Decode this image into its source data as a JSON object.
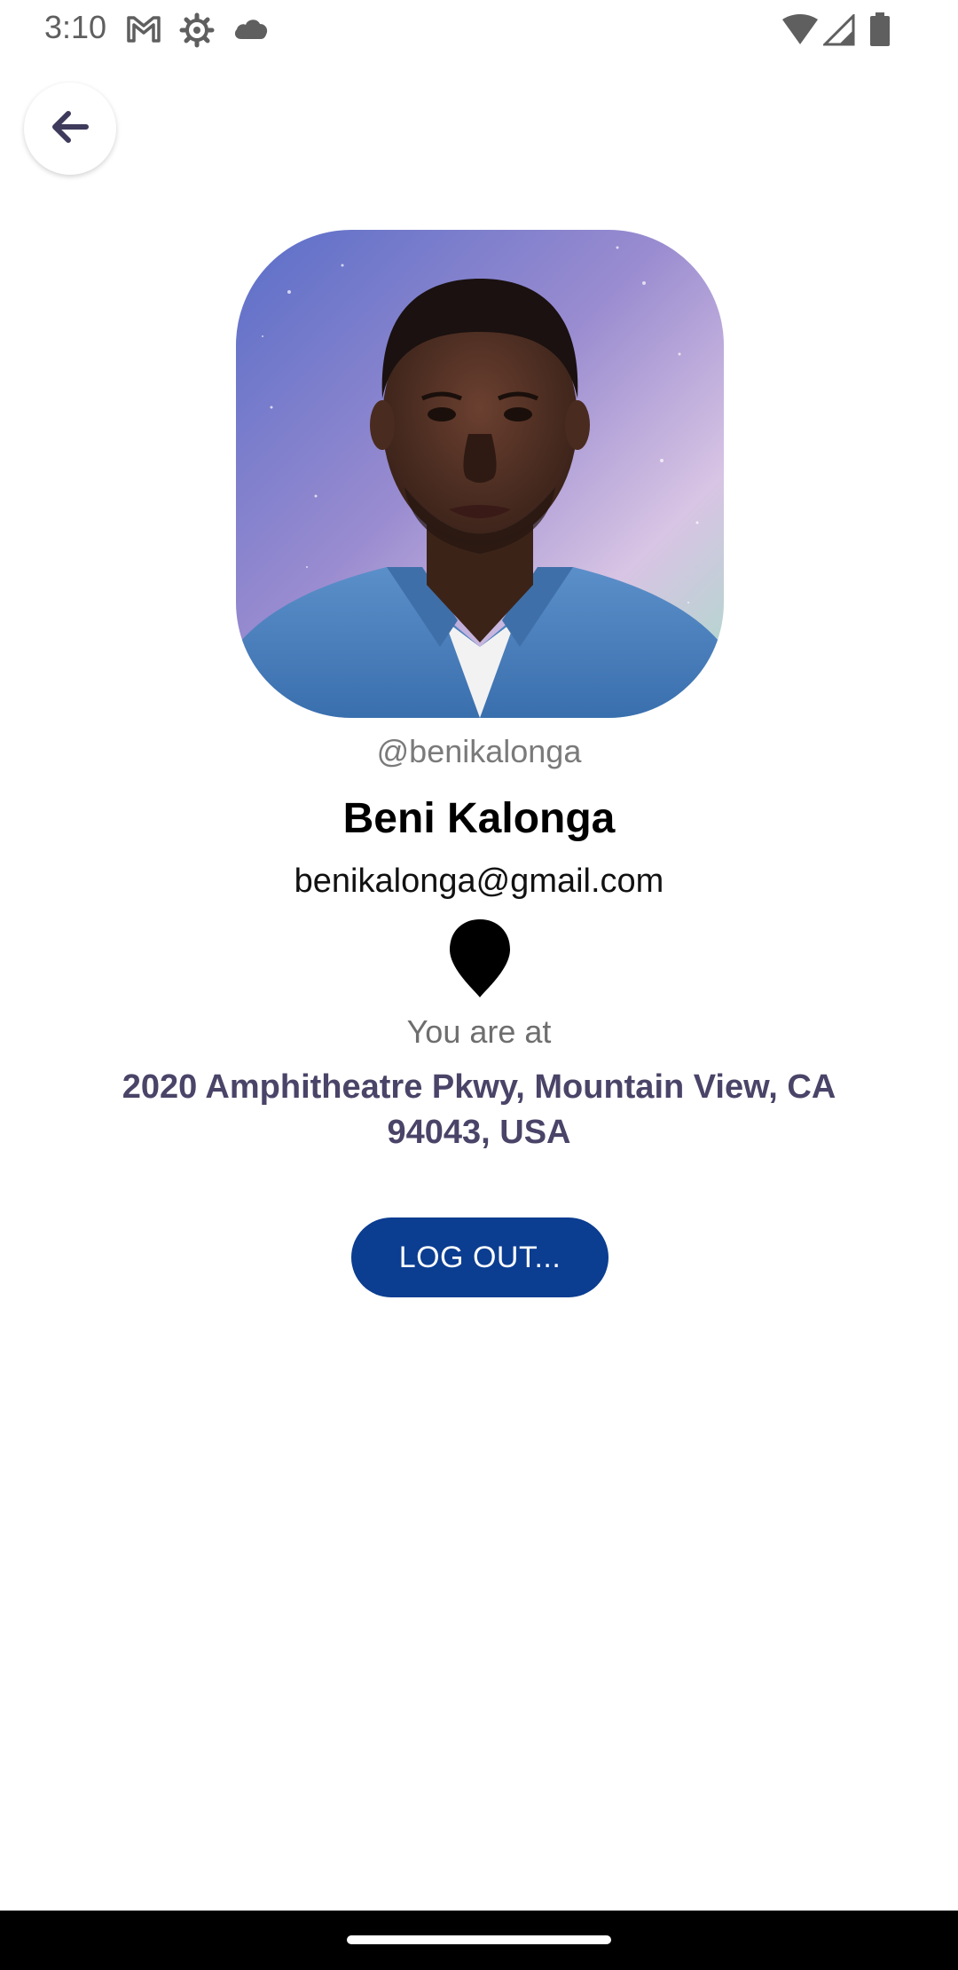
{
  "status_bar": {
    "time": "3:10",
    "left_icons": [
      "gmail-icon",
      "settings-icon",
      "cloud-icon"
    ],
    "right_icons": [
      "wifi-icon",
      "cellular-signal-icon",
      "battery-icon"
    ]
  },
  "header": {
    "back_icon": "arrow-left-icon"
  },
  "profile": {
    "username": "@benikalonga",
    "full_name": "Beni Kalonga",
    "email": "benikalonga@gmail.com"
  },
  "location": {
    "icon": "location-pin-icon",
    "label": "You are at",
    "address": "2020 Amphitheatre Pkwy, Mountain View, CA 94043, USA"
  },
  "actions": {
    "logout_label": "LOG OUT..."
  },
  "colors": {
    "accent_button": "#0b3d91",
    "address_text": "#4a4468",
    "back_arrow": "#3d3a5c"
  }
}
